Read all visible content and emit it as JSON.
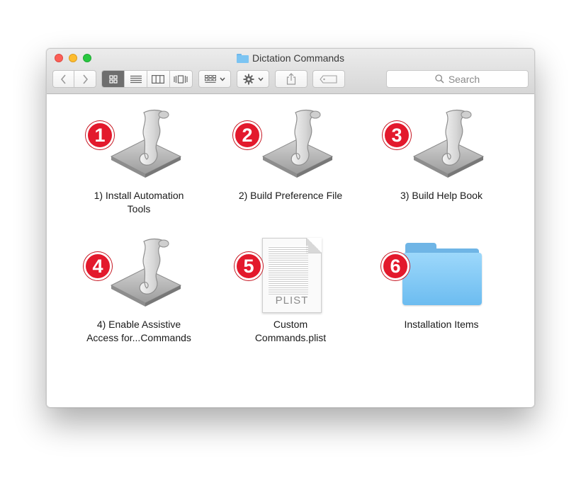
{
  "window": {
    "title": "Dictation Commands",
    "traffic_lights": [
      "close",
      "minimize",
      "zoom"
    ]
  },
  "toolbar": {
    "back_icon": "chevron-left-icon",
    "forward_icon": "chevron-right-icon",
    "view_modes": [
      "icon-view",
      "list-view",
      "column-view",
      "cover-flow-view"
    ],
    "active_view": "icon-view",
    "arrange_icon": "arrange-grid-icon",
    "action_icon": "gear-icon",
    "share_icon": "share-icon",
    "tag_icon": "tag-icon",
    "search_placeholder": "Search"
  },
  "items": [
    {
      "badge": "1",
      "label": "1) Install Automation\nTools",
      "kind": "automator-app"
    },
    {
      "badge": "2",
      "label": "2) Build Preference File",
      "kind": "automator-app"
    },
    {
      "badge": "3",
      "label": "3) Build Help Book",
      "kind": "automator-app"
    },
    {
      "badge": "4",
      "label": "4) Enable Assistive\nAccess for...Commands",
      "kind": "automator-app"
    },
    {
      "badge": "5",
      "label": "Custom\nCommands.plist",
      "kind": "plist-file",
      "file_tag": "PLIST"
    },
    {
      "badge": "6",
      "label": "Installation Items",
      "kind": "folder"
    }
  ],
  "colors": {
    "badge": "#e3192c",
    "folder": "#7cc4f2",
    "active_segment": "#6e6e6e"
  }
}
